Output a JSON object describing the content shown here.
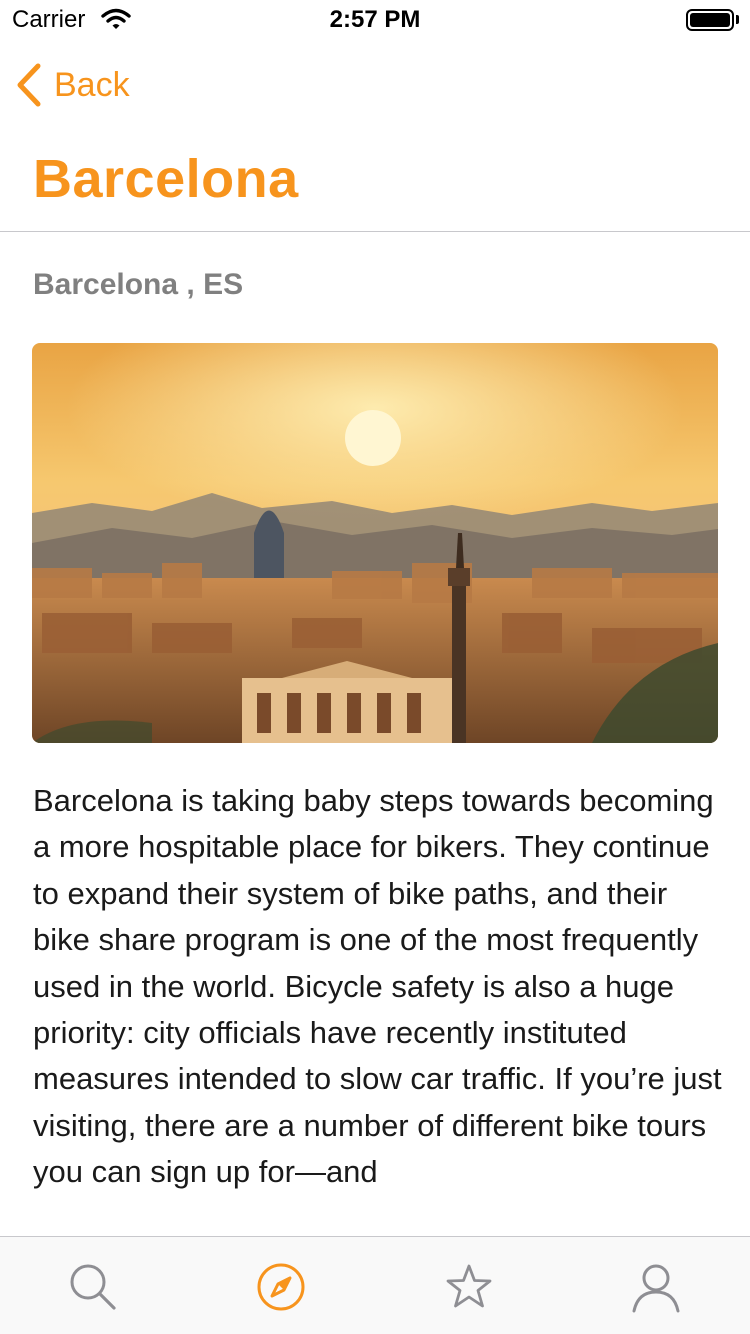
{
  "status_bar": {
    "carrier": "Carrier",
    "time": "2:57 PM"
  },
  "nav": {
    "back_label": "Back",
    "title": "Barcelona"
  },
  "location": "Barcelona , ES",
  "hero_image": {
    "icon": "city-skyline-photo"
  },
  "description": "Barcelona is taking baby steps towards becoming a more hospitable place for bikers. They continue to expand their system of bike paths, and their bike share program is one of the most frequently used in the world. Bicycle safety is also a huge priority: city officials have recently instituted measures intended to slow car traffic. If you’re just visiting, there are a number of different bike tours you can sign up for—and",
  "tab_bar": {
    "tabs": [
      {
        "icon": "search-icon",
        "selected": false
      },
      {
        "icon": "compass-icon",
        "selected": true
      },
      {
        "icon": "star-icon",
        "selected": false
      },
      {
        "icon": "profile-icon",
        "selected": false
      }
    ]
  },
  "colors": {
    "accent": "#f7941d",
    "inactive_tab": "#8e8e93",
    "subtitle": "#808080"
  }
}
